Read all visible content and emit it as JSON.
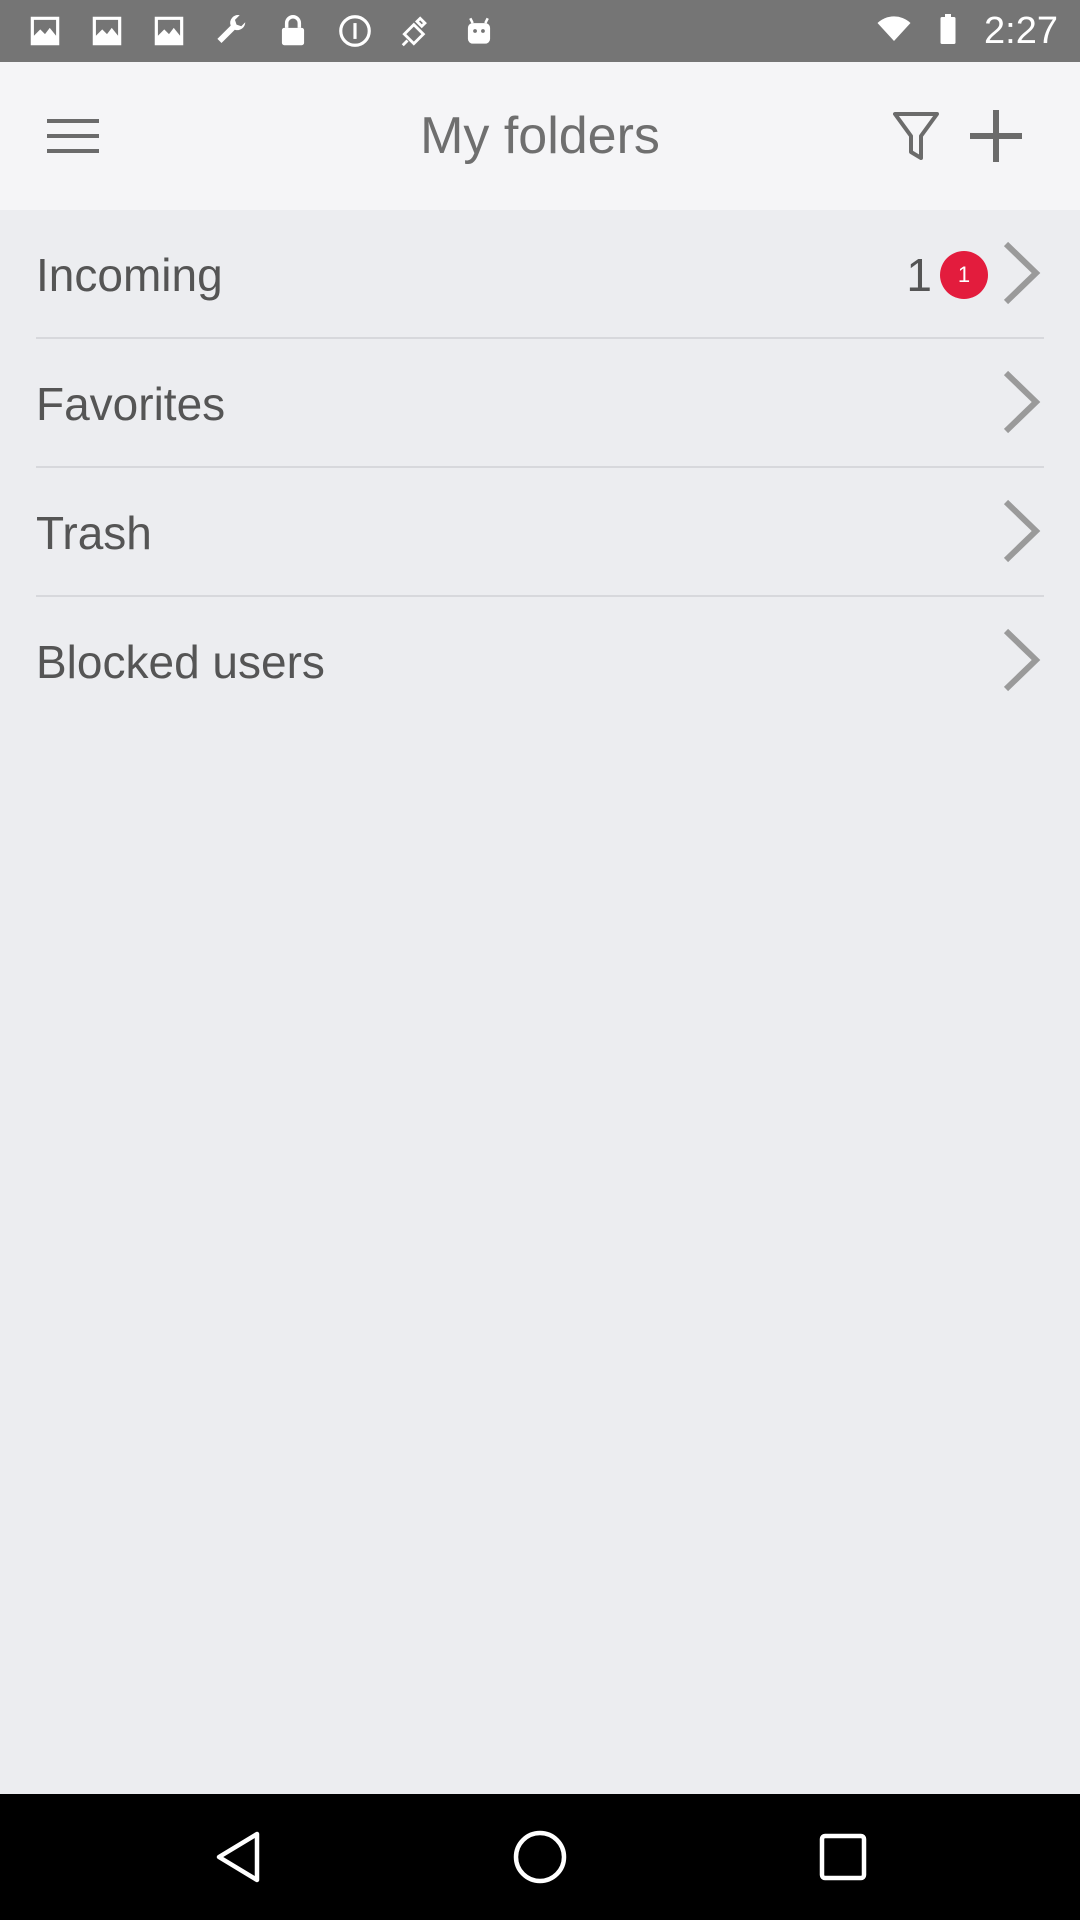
{
  "status_bar": {
    "time": "2:27",
    "icons": [
      "photo-icon",
      "photo-icon",
      "photo-icon",
      "wrench-icon",
      "lock-icon",
      "info-circle-icon",
      "satellite-icon",
      "android-icon"
    ],
    "right_icons": [
      "wifi-icon",
      "battery-icon"
    ]
  },
  "header": {
    "title": "My folders",
    "menu_icon": "hamburger-menu-icon",
    "filter_icon": "filter-icon",
    "add_icon": "plus-icon"
  },
  "folders": [
    {
      "label": "Incoming",
      "count": "1",
      "badge": "1"
    },
    {
      "label": "Favorites"
    },
    {
      "label": "Trash"
    },
    {
      "label": "Blocked users"
    }
  ],
  "nav_bar": {
    "back_icon": "back-triangle-icon",
    "home_icon": "home-circle-icon",
    "recent_icon": "recents-square-icon"
  },
  "colors": {
    "status_bar": "#757575",
    "app_bar": "#f5f5f7",
    "background": "#ecedf0",
    "badge": "#e31c3d",
    "text": "#555555",
    "nav_bar": "#000000"
  }
}
